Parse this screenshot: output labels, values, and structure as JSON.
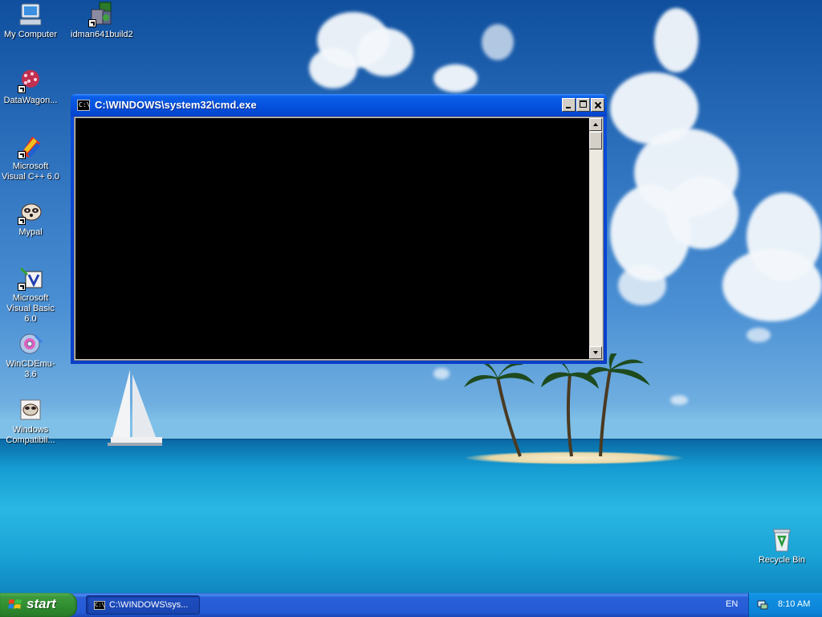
{
  "desktop_icons": [
    {
      "label": "My Computer"
    },
    {
      "label": "idman641build2"
    },
    {
      "label": "DataWagon..."
    },
    {
      "label": "Microsoft Visual C++ 6.0"
    },
    {
      "label": "Mypal"
    },
    {
      "label": "Microsoft Visual Basic 6.0"
    },
    {
      "label": "WinCDEmu-3.6"
    },
    {
      "label": "Windows Compatibil..."
    },
    {
      "label": "Recycle Bin"
    }
  ],
  "window": {
    "title": "C:\\WINDOWS\\system32\\cmd.exe",
    "icon_text": "C:\\"
  },
  "taskbar": {
    "start_label": "start",
    "task_label": "C:\\WINDOWS\\sys...",
    "task_icon_text": "C:\\",
    "language": "EN",
    "clock": "8:10 AM"
  }
}
